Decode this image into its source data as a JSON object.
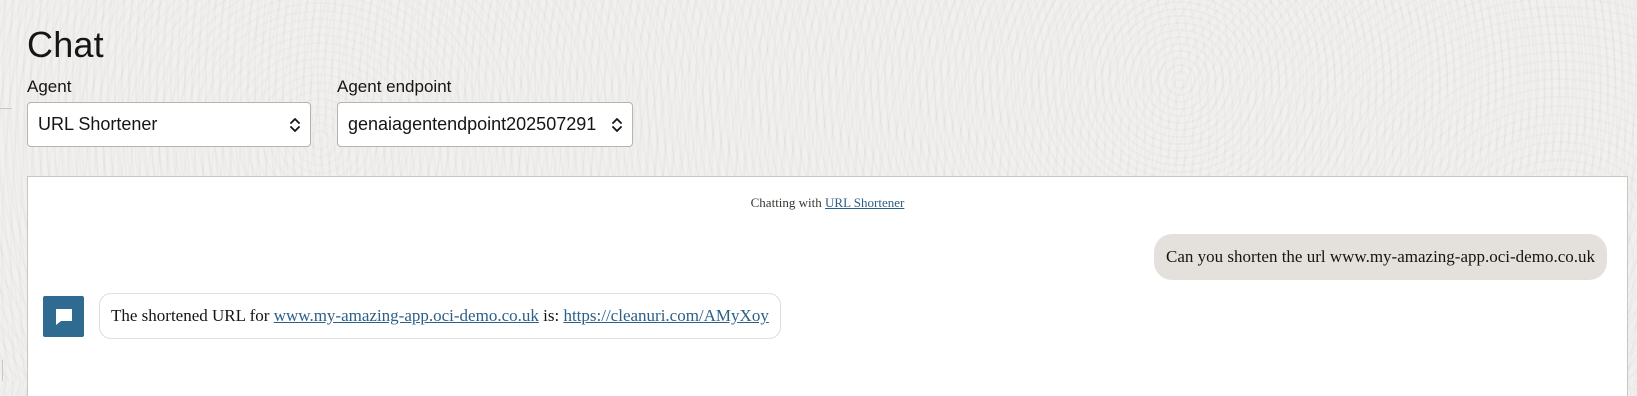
{
  "page": {
    "title": "Chat"
  },
  "agent_select": {
    "label": "Agent",
    "value": "URL Shortener"
  },
  "endpoint_select": {
    "label": "Agent endpoint",
    "value": "genaiagentendpoint202507291"
  },
  "chat": {
    "header_prefix": "Chatting with ",
    "header_agent_link": "URL Shortener",
    "messages": [
      {
        "role": "user",
        "text": "Can you shorten the url www.my-amazing-app.oci-demo.co.uk"
      },
      {
        "role": "agent",
        "text_before": "The shortened URL for ",
        "link1": "www.my-amazing-app.oci-demo.co.uk",
        "text_middle": " is: ",
        "link2": "https://cleanuri.com/AMyXoy"
      }
    ]
  },
  "icons": {
    "select_chevron": "chevron-up-down-icon",
    "agent_avatar": "chat-bubble-icon"
  },
  "colors": {
    "link": "#2c5f87",
    "avatar": "#2f6b91",
    "user_bubble": "#e4e1dc"
  }
}
